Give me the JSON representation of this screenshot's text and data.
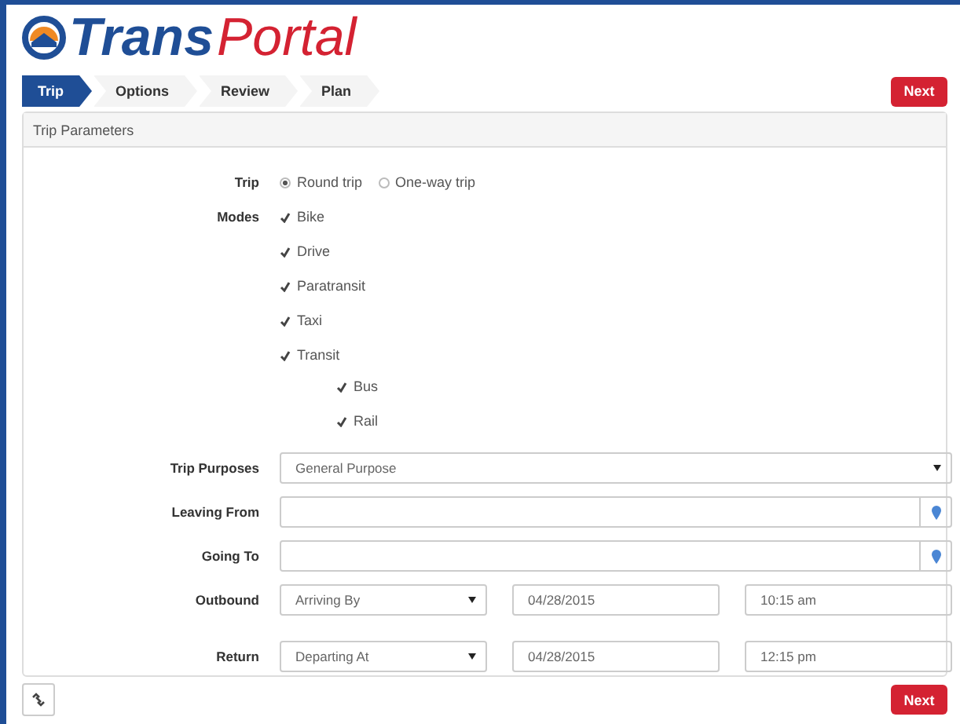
{
  "logo": {
    "part_1": "Trans",
    "part_2": "Portal"
  },
  "steps": [
    {
      "label": "Trip",
      "selected": true
    },
    {
      "label": "Options",
      "selected": false
    },
    {
      "label": "Review",
      "selected": false
    },
    {
      "label": "Plan",
      "selected": false
    }
  ],
  "top_button": "Next",
  "panel_title": "Trip Parameters",
  "trip": {
    "label": "Trip",
    "options": [
      {
        "label": "Round trip",
        "selected": true
      },
      {
        "label": "One-way trip",
        "selected": false
      }
    ]
  },
  "modes": {
    "label": "Modes",
    "items": [
      {
        "label": "Bike",
        "checked": true
      },
      {
        "label": "Drive",
        "checked": true
      },
      {
        "label": "Paratransit",
        "checked": true
      },
      {
        "label": "Taxi",
        "checked": true
      },
      {
        "label": "Transit",
        "checked": true,
        "children": [
          {
            "label": "Bus",
            "checked": true
          },
          {
            "label": "Rail",
            "checked": true
          }
        ]
      }
    ]
  },
  "trip_purposes": {
    "label": "Trip Purposes",
    "value": "General Purpose"
  },
  "leaving_from": {
    "label": "Leaving From"
  },
  "going_to": {
    "label": "Going To"
  },
  "schedule": [
    {
      "label": "Outbound",
      "mode": "Arriving By",
      "date": "04/28/2015",
      "time": "10:15 am"
    },
    {
      "label": "Return",
      "mode": "Departing At",
      "date": "04/28/2015",
      "time": "12:15 pm"
    }
  ],
  "bottom_button": "Next"
}
